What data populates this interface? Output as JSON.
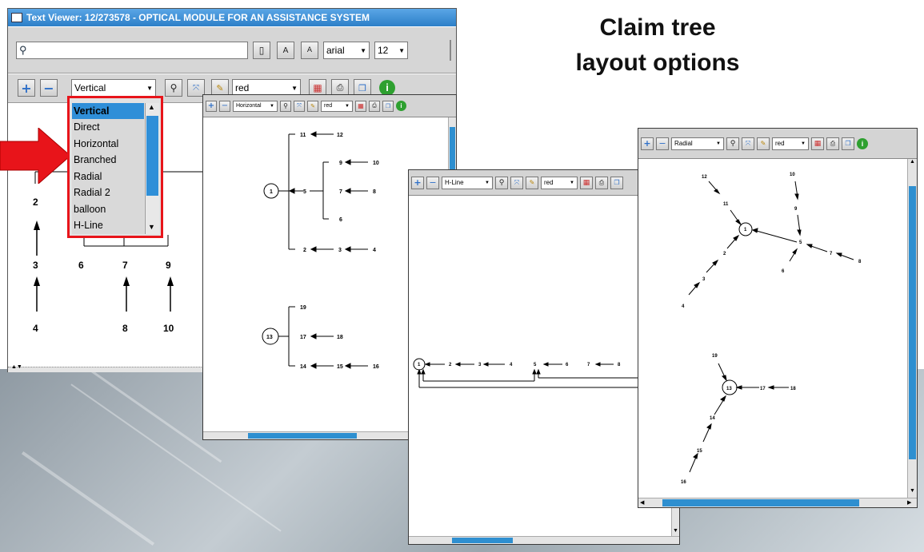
{
  "heading": {
    "line1": "Claim tree",
    "line2": "layout options"
  },
  "main_window": {
    "title": "Text Viewer:  12/273578 - OPTICAL MODULE FOR AN ASSISTANCE SYSTEM",
    "search": {
      "value": "",
      "placeholder": ""
    },
    "font_family": "arial",
    "font_size": "12",
    "layout_selected": "Vertical",
    "color_selected": "red",
    "dropdown_options": [
      "Vertical",
      "Direct",
      "Horizontal",
      "Branched",
      "Radial",
      "Radial 2",
      "balloon",
      "H-Line"
    ],
    "tree_numbers": [
      "2",
      "3",
      "4",
      "6",
      "7",
      "8",
      "9",
      "10"
    ]
  },
  "horizontal_window": {
    "layout_selected": "Horizontal",
    "color_selected": "red",
    "nodes": [
      "1",
      "5",
      "11",
      "12",
      "9",
      "10",
      "7",
      "8",
      "6",
      "2",
      "3",
      "4",
      "13",
      "19",
      "17",
      "18",
      "14",
      "15",
      "16"
    ]
  },
  "hline_window": {
    "layout_selected": "H-Line",
    "color_selected": "red",
    "nodes": [
      "1",
      "2",
      "3",
      "4",
      "5",
      "6",
      "7",
      "8"
    ]
  },
  "radial_window": {
    "layout_selected": "Radial",
    "color_selected": "red",
    "nodes": [
      "1",
      "2",
      "3",
      "4",
      "5",
      "6",
      "7",
      "8",
      "9",
      "10",
      "11",
      "12",
      "13",
      "14",
      "15",
      "16",
      "17",
      "18",
      "19"
    ]
  },
  "colors": {
    "accent_blue": "#2e8fd0",
    "highlight_red": "#e8141a",
    "selection_blue": "#2f8fd8"
  }
}
